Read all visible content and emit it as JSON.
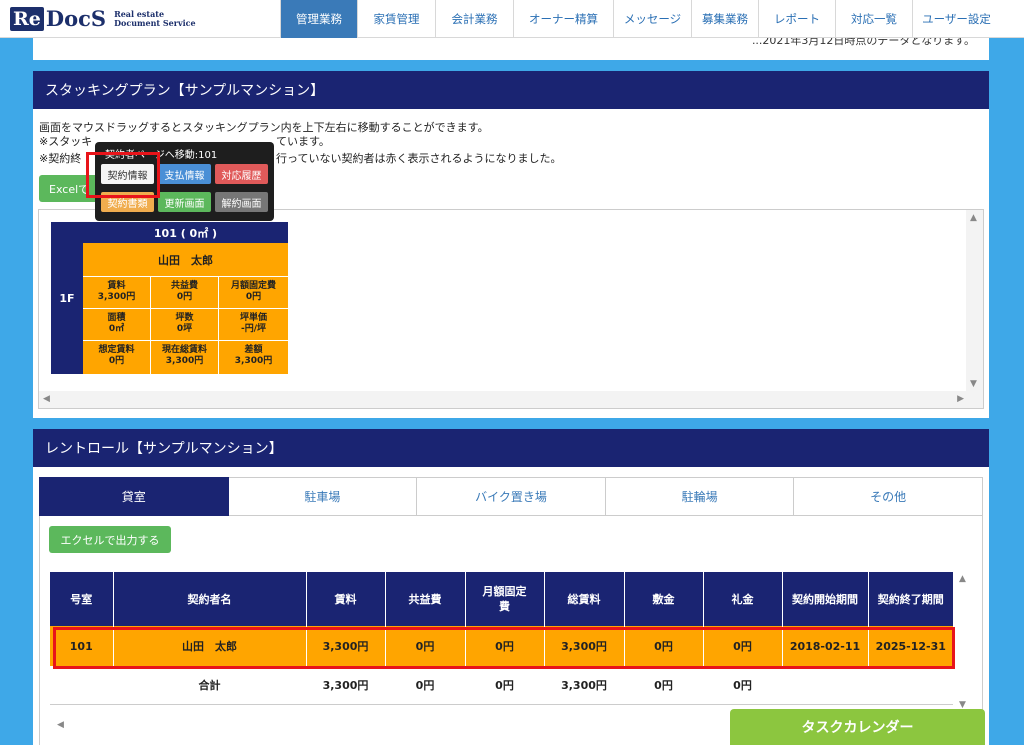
{
  "brand": {
    "logo_re": "Re",
    "logo_docs": "DocS",
    "tagline1": "Real estate",
    "tagline2": "Document Service"
  },
  "nav": [
    "管理業務",
    "家賃管理",
    "会計業務",
    "オーナー精算",
    "メッセージ",
    "募集業務",
    "レポート",
    "対応一覧",
    "ユーザー設定"
  ],
  "notice": "...2021年3月12日時点のデータとなります。",
  "stacking": {
    "title": "スタッキングプラン【サンプルマンション】",
    "desc1": "画面をマウスドラッグするとスタッキングプラン内を上下左右に移動することができます。",
    "desc2a": "※スタッキ",
    "desc2b": "ています。",
    "desc3a": "※契約終",
    "desc3b": "行っていない契約者は赤く表示されるようになりました。",
    "excel_label": "Excelで",
    "unit": {
      "floor": "1F",
      "room": "101 ( 0㎡ )",
      "tenant": "山田　太郎",
      "cells": [
        {
          "label": "賃料",
          "value": "3,300円"
        },
        {
          "label": "共益費",
          "value": "0円"
        },
        {
          "label": "月額固定費",
          "value": "0円"
        },
        {
          "label": "面積",
          "value": "0㎡"
        },
        {
          "label": "坪数",
          "value": "0坪"
        },
        {
          "label": "坪単価",
          "value": "-円/坪"
        },
        {
          "label": "想定賃料",
          "value": "0円"
        },
        {
          "label": "現在総賃料",
          "value": "3,300円"
        },
        {
          "label": "差額",
          "value": "3,300円"
        }
      ]
    },
    "popup": {
      "title": "契約者ページへ移動:101",
      "buttons": [
        "契約情報",
        "支払情報",
        "対応履歴",
        "契約書類",
        "更新画面",
        "解約画面"
      ]
    }
  },
  "rentroll": {
    "title": "レントロール【サンプルマンション】",
    "tabs": [
      "貸室",
      "駐車場",
      "バイク置き場",
      "駐輪場",
      "その他"
    ],
    "excel_label": "エクセルで出力する",
    "headers": [
      "号室",
      "契約者名",
      "賃料",
      "共益費",
      "月額固定費",
      "総賃料",
      "敷金",
      "礼金",
      "契約開始期間",
      "契約終了期間"
    ],
    "row": [
      "101",
      "山田　太郎",
      "3,300円",
      "0円",
      "0円",
      "3,300円",
      "0円",
      "0円",
      "2018-02-11",
      "2025-12-31"
    ],
    "total": [
      "",
      "合計",
      "3,300円",
      "0円",
      "0円",
      "3,300円",
      "0円",
      "0円",
      "",
      ""
    ]
  },
  "task_calendar": "タスクカレンダー"
}
